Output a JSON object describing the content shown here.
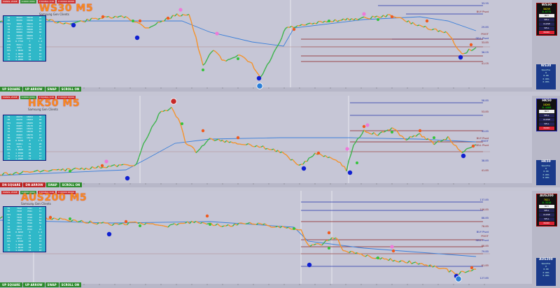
{
  "panes": [
    {
      "id": "ws30",
      "symbol_title": "WS30 M5",
      "subtitle": "Samsung Gen Clients",
      "topbar": [
        "SIGNAL ZONE",
        "0.0000 0000",
        "0 SIGNAL 0.00",
        "0 00000 00000"
      ],
      "buttons": [
        {
          "label": "UP SQUARE",
          "color": "green"
        },
        {
          "label": "UP ARROW",
          "color": "green"
        },
        {
          "label": "SWAP",
          "color": "green"
        },
        {
          "label": "SCROLL ON",
          "color": "green"
        }
      ],
      "table_rows": [
        [
          "M1",
          "30236",
          "30246",
          "25"
        ],
        [
          "M5",
          "30236",
          "30246",
          "10"
        ],
        [
          "M15",
          "0000",
          "30241",
          "25"
        ],
        [
          "H1",
          "30231",
          "30111",
          "15"
        ],
        [
          "H4",
          "29971",
          "30046",
          "75"
        ],
        [
          "D1",
          "30046",
          "30256",
          "58"
        ],
        [
          "W1",
          "30496",
          "30266",
          "7"
        ],
        [
          "MN",
          "13030",
          "30171",
          "10"
        ],
        [
          "SPR",
          "0.7750",
          "7",
          "1.4"
        ],
        [
          "ATR",
          "36611",
          "69",
          "31"
        ],
        [
          "VOL",
          "4781",
          "84",
          "56"
        ],
        [
          "PIV",
          "1.0820",
          "56",
          "16"
        ],
        [
          "R1",
          "1.0800",
          "47",
          "10"
        ],
        [
          "S1",
          "3.0810",
          "42",
          "12"
        ],
        [
          "TP",
          "1.2000",
          "10",
          "11"
        ]
      ],
      "levels": [
        "33.95",
        "BUY Pivot",
        "29.85",
        "PIVOT",
        "SELL Pivot",
        "33.85",
        "36.05",
        "41.05"
      ],
      "side": {
        "title": "WS30",
        "values": [
          "30259",
          "0.6775"
        ],
        "buttons": [
          "BUY",
          "SELL",
          "CLOSE",
          "SELL",
          "PANIC"
        ],
        "panel_title": "WS30",
        "panel_values": [
          "OpenPos",
          "0",
          "0.00",
          "0.00%",
          "0.00%"
        ]
      }
    },
    {
      "id": "hk50",
      "symbol_title": "HK50 M5",
      "subtitle": "Samsung Gen Clients",
      "topbar": [
        "SIGNAL ZONE",
        "0.0000 0000",
        "0 SIGNAL 0.00",
        "0 00000 00000"
      ],
      "buttons": [
        {
          "label": "DN SQUARE",
          "color": "red"
        },
        {
          "label": "DN ARROW",
          "color": "red"
        },
        {
          "label": "SWAP",
          "color": "green"
        },
        {
          "label": "SCROLL ON",
          "color": "green"
        }
      ],
      "table_rows": [
        [
          "M1",
          "18270",
          "18262",
          "30"
        ],
        [
          "M5",
          "18270",
          "18262",
          "18"
        ],
        [
          "M15",
          "18245",
          "18265",
          "30"
        ],
        [
          "H1",
          "18205",
          "18176",
          "24"
        ],
        [
          "H4",
          "18095",
          "18161",
          "69"
        ],
        [
          "D1",
          "18142",
          "18216",
          "67"
        ],
        [
          "W1",
          "18460",
          "18276",
          "13"
        ],
        [
          "MN",
          "10811",
          "18119",
          "26"
        ],
        [
          "SPR",
          "0.8150",
          "8",
          "1.5"
        ],
        [
          "ATR",
          "16501",
          "74",
          "28"
        ],
        [
          "VOL",
          "3971",
          "81",
          "47"
        ],
        [
          "PIV",
          "1.0800",
          "45",
          "15"
        ],
        [
          "R1",
          "1.0700",
          "40",
          "12"
        ],
        [
          "S1",
          "2.0710",
          "39",
          "14"
        ],
        [
          "TP",
          "1.2400",
          "14",
          "12"
        ]
      ],
      "levels": [
        "58.85",
        "53.85",
        "33.85",
        "BUY Pivot",
        "PIVOT",
        "SELL Pivot",
        "38.85",
        "41.85"
      ],
      "side": {
        "title": "HK50",
        "values": [
          "18265",
          "0.4460"
        ],
        "buttons": [
          "BUY",
          "SELL",
          "CLOSE",
          "SELL",
          "PANIC"
        ],
        "panel_title": "HK50",
        "panel_values": [
          "OpenPos",
          "0",
          "0.00",
          "0.00%",
          "0.00%"
        ]
      }
    },
    {
      "id": "aus200",
      "symbol_title": "AUS200 M5",
      "subtitle": "Samsung Gen Clients",
      "topbar": [
        "SIGNAL ZONE",
        "0.0000 0000",
        "0 SIGNAL 0.00",
        "0 00000 00000"
      ],
      "buttons": [
        {
          "label": "UP SQUARE",
          "color": "green"
        },
        {
          "label": "UP ARROW",
          "color": "green"
        },
        {
          "label": "SWAP",
          "color": "green"
        },
        {
          "label": "SCROLL ON",
          "color": "green"
        }
      ],
      "table_rows": [
        [
          "M1",
          "7020",
          "7021",
          "21"
        ],
        [
          "M5",
          "7020",
          "7021",
          "11"
        ],
        [
          "M15",
          "7018",
          "7022",
          "19"
        ],
        [
          "H1",
          "7016",
          "7010",
          "14"
        ],
        [
          "H4",
          "7005",
          "7011",
          "62"
        ],
        [
          "D1",
          "7011",
          "7019",
          "54"
        ],
        [
          "W1",
          "7033",
          "7023",
          "9"
        ],
        [
          "MN",
          "6911",
          "7012",
          "21"
        ],
        [
          "SPR",
          "0.6650",
          "6",
          "1.2"
        ],
        [
          "ATR",
          "13211",
          "54",
          "24"
        ],
        [
          "VOL",
          "2811",
          "71",
          "42"
        ],
        [
          "PIV",
          "1.0700",
          "42",
          "13"
        ],
        [
          "R1",
          "1.0600",
          "38",
          "10"
        ],
        [
          "S1",
          "1.0610",
          "33",
          "11"
        ],
        [
          "TP",
          "1.1900",
          "12",
          "10"
        ]
      ],
      "levels": [
        "137.85",
        "106.85",
        "88.85",
        "78.85",
        "BUY Pivot",
        "PIVOT",
        "SELL Pivot",
        "88.85",
        "79.85",
        "61.85",
        "127.85"
      ],
      "side": {
        "title": "AUS200",
        "values": [
          "7021",
          "0.3310"
        ],
        "buttons": [
          "BUY",
          "SELL",
          "CLOSE",
          "SELL",
          "PANIC"
        ],
        "panel_title": "AUS200",
        "panel_values": [
          "OpenPos",
          "0",
          "0.00",
          "0.00%",
          "0.00%"
        ]
      }
    }
  ],
  "colors": {
    "price_line": "#f5922a",
    "price_line_up": "#3cb44b",
    "ma_line": "#3b7fd9",
    "blue_level": "#1f2fa8",
    "red_level": "#8b1e1e",
    "dot_blue": "#1020d0",
    "dot_green": "#34c43a",
    "dot_orange": "#f05a1e",
    "dot_pink": "#ee7ad8"
  }
}
